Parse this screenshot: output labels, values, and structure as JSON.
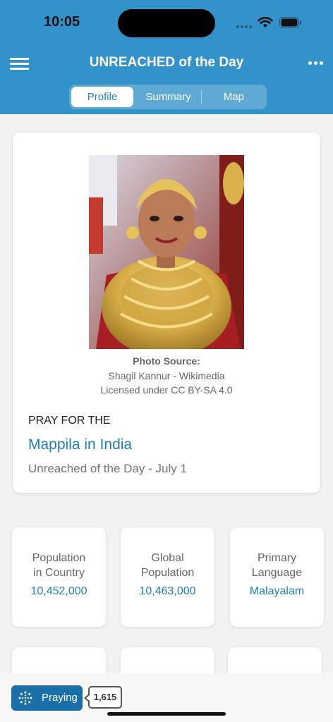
{
  "status_bar": {
    "time": "10:05"
  },
  "header": {
    "title": "UNREACHED of the Day",
    "tabs": [
      {
        "label": "Profile",
        "active": true
      },
      {
        "label": "Summary",
        "active": false
      },
      {
        "label": "Map",
        "active": false
      }
    ]
  },
  "profile": {
    "photo_source_label": "Photo Source:",
    "photo_author": "Shagil Kannur - Wikimedia",
    "photo_license": "Licensed under CC BY-SA 4.0",
    "pray_for": "PRAY FOR THE",
    "people_group": "Mappila in India",
    "subtitle": "Unreached of the Day - July 1"
  },
  "stats": [
    {
      "label": "Population in Country",
      "value": "10,452,000"
    },
    {
      "label": "Global Population",
      "value": "10,463,000"
    },
    {
      "label": "Primary Language",
      "value": "Malayalam"
    }
  ],
  "praying": {
    "label": "Praying",
    "count": "1,615"
  },
  "colors": {
    "header": "#3392c9",
    "accent": "#1f7fb8",
    "button": "#1a6fa9"
  }
}
